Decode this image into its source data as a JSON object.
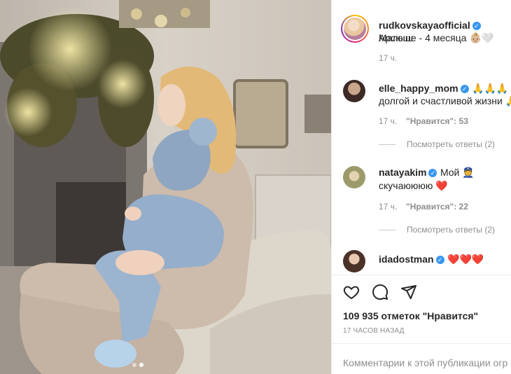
{
  "post": {
    "author": "rudkovskaya​official",
    "caption_line1": "Малыш",
    "caption_line2": "Арсюше - 4 месяца 👶🏼🤍",
    "time": "17 ч."
  },
  "comments": [
    {
      "user": "elle_happy_mom",
      "text_line1": "🙏🙏🙏",
      "text_line2": "долгой и счастливой жизни 🙏",
      "time": "17 ч.",
      "likes": "\"Нравится\": 53",
      "replies": "Посмотреть ответы (2)"
    },
    {
      "user": "natayakim",
      "text_line1": "Мой 👮",
      "text_line2": "скучаюююю ❤️",
      "time": "17 ч.",
      "likes": "\"Нравится\": 22",
      "replies": "Посмотреть ответы (2)"
    },
    {
      "user": "idadostman",
      "text_line1": "❤️❤️❤️"
    }
  ],
  "footer": {
    "likes_count": "109 935 отметок \"Нравится\"",
    "date": "17 ЧАСОВ НАЗАД",
    "comment_placeholder": "Комментарии к этой публикации огр"
  },
  "icons": {
    "like": "heart-outline-icon",
    "comment": "speech-bubble-icon",
    "share": "paper-plane-icon",
    "verified": "verified-badge-icon"
  },
  "colors": {
    "verified": "#3897f0",
    "link_gray": "#8e8e8e",
    "heart_red": "#ed4956"
  }
}
